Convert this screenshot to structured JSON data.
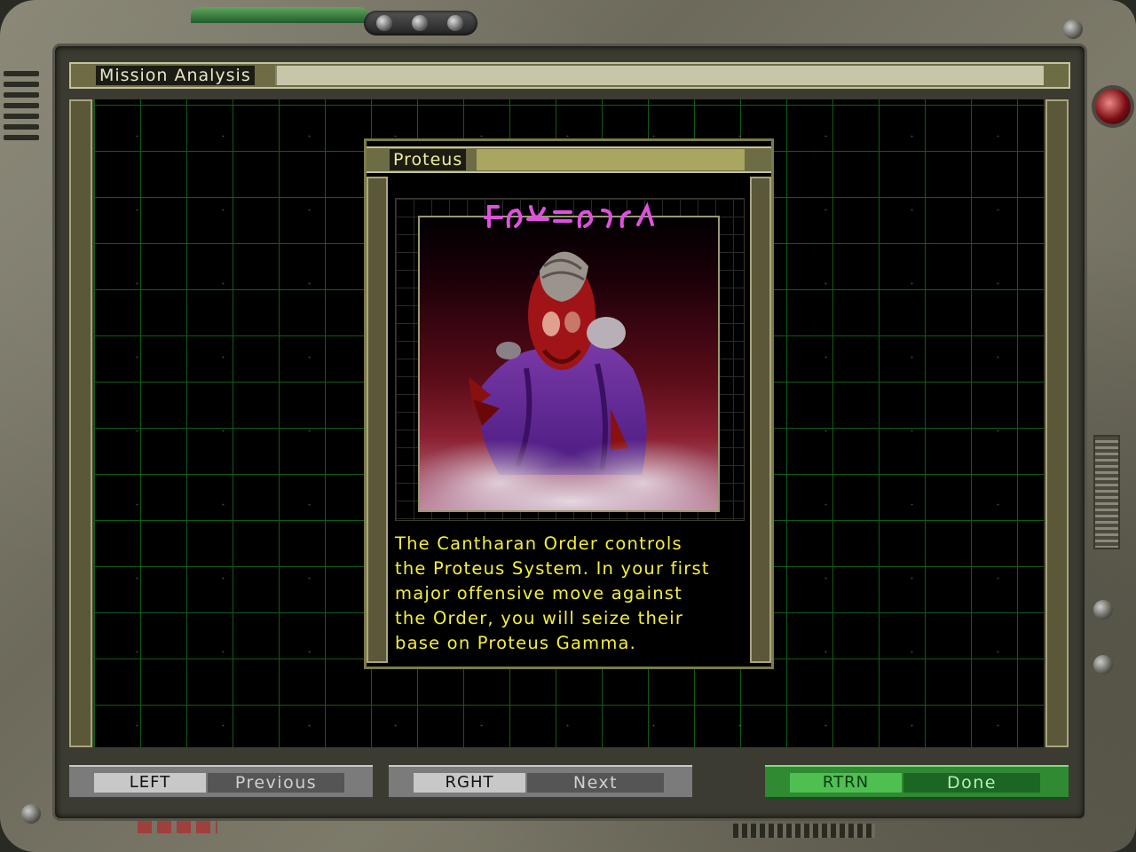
{
  "window": {
    "title": "Mission Analysis"
  },
  "dossier": {
    "title": "Proteus",
    "portrait_caption_glyphs": "alien-script-glyphs",
    "description": "The Cantharan Order controls\nthe Proteus System. In your first\nmajor offensive move against\nthe Order, you will seize their\nbase on Proteus Gamma."
  },
  "buttons": {
    "previous": {
      "key": "LEFT",
      "label": "Previous"
    },
    "next": {
      "key": "RGHT",
      "label": "Next"
    },
    "done": {
      "key": "RTRN",
      "label": "Done"
    }
  },
  "colors": {
    "grid_line": "#0f5d14",
    "text_yellow": "#f4ef3a",
    "panel_olive": "#6e6c44",
    "done_green": "#2f8a32"
  }
}
